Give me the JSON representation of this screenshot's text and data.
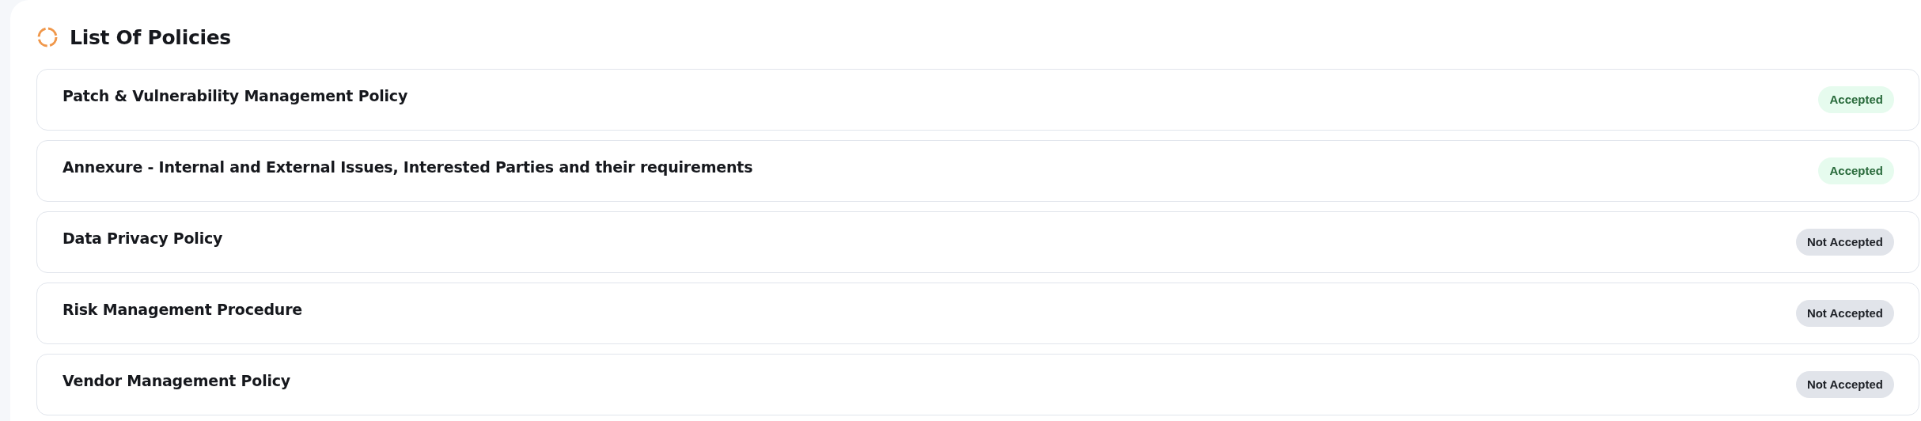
{
  "title": "List Of Policies",
  "policies": [
    {
      "name": "Patch & Vulnerability Management Policy",
      "status": "Accepted",
      "accepted": true
    },
    {
      "name": "Annexure - Internal and External Issues, Interested Parties and their requirements",
      "status": "Accepted",
      "accepted": true
    },
    {
      "name": "Data Privacy Policy",
      "status": "Not Accepted",
      "accepted": false
    },
    {
      "name": "Risk Management Procedure",
      "status": "Not Accepted",
      "accepted": false
    },
    {
      "name": "Vendor Management Policy",
      "status": "Not Accepted",
      "accepted": false
    }
  ]
}
